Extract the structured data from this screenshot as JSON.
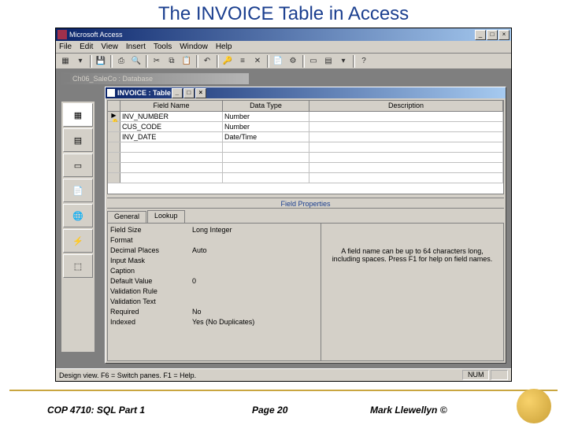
{
  "slide": {
    "title": "The INVOICE Table in Access"
  },
  "app": {
    "title": "Microsoft Access",
    "menus": [
      "File",
      "Edit",
      "View",
      "Insert",
      "Tools",
      "Window",
      "Help"
    ],
    "db_window": "Ch06_SaleCo : Database",
    "table_window": "INVOICE : Table",
    "grid_headers": {
      "field": "Field Name",
      "type": "Data Type",
      "desc": "Description"
    },
    "rows": [
      {
        "pk": true,
        "field": "INV_NUMBER",
        "type": "Number"
      },
      {
        "pk": false,
        "field": "CUS_CODE",
        "type": "Number"
      },
      {
        "pk": false,
        "field": "INV_DATE",
        "type": "Date/Time"
      }
    ],
    "props_divider": "Field Properties",
    "tabs": [
      "General",
      "Lookup"
    ],
    "props": [
      {
        "label": "Field Size",
        "value": "Long Integer"
      },
      {
        "label": "Format",
        "value": ""
      },
      {
        "label": "Decimal Places",
        "value": "Auto"
      },
      {
        "label": "Input Mask",
        "value": ""
      },
      {
        "label": "Caption",
        "value": ""
      },
      {
        "label": "Default Value",
        "value": "0"
      },
      {
        "label": "Validation Rule",
        "value": ""
      },
      {
        "label": "Validation Text",
        "value": ""
      },
      {
        "label": "Required",
        "value": "No"
      },
      {
        "label": "Indexed",
        "value": "Yes (No Duplicates)"
      }
    ],
    "help_text": "A field name can be up to 64 characters long, including spaces. Press F1 for help on field names.",
    "status_left": "Design view.  F6 = Switch panes.  F1 = Help.",
    "status_right": "NUM"
  },
  "footer": {
    "left": "COP 4710: SQL Part 1",
    "center": "Page 20",
    "right": "Mark Llewellyn ©"
  }
}
